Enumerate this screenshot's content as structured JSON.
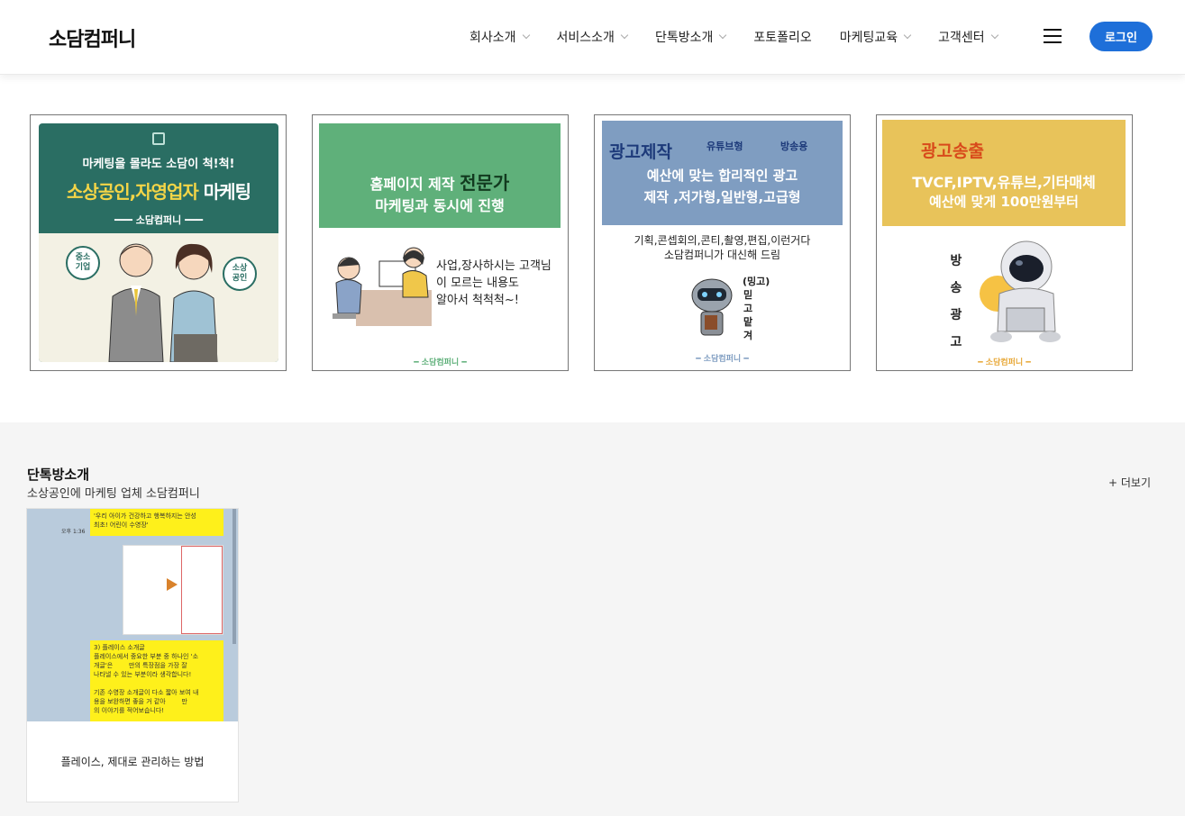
{
  "header": {
    "logo": "소담컴퍼니",
    "nav": [
      {
        "label": "회사소개",
        "has_dropdown": true
      },
      {
        "label": "서비스소개",
        "has_dropdown": true
      },
      {
        "label": "단톡방소개",
        "has_dropdown": true
      },
      {
        "label": "포토폴리오",
        "has_dropdown": false
      },
      {
        "label": "마케팅교육",
        "has_dropdown": true
      },
      {
        "label": "고객센터",
        "has_dropdown": true
      }
    ],
    "menu_icon": "hamburger-icon",
    "login_label": "로그인",
    "accent_color": "#1e6fd9"
  },
  "banners": [
    {
      "top_text": "마케팅을 몰라도 소담이 척!척!",
      "main_highlight": "소상공인,자영업자",
      "main_rest": "마케팅",
      "brand": "━━━ 소담컴퍼니 ━━━",
      "badge_left": "중소\n기업",
      "badge_right": "소상\n공인",
      "bg_color": "#2a6e63"
    },
    {
      "line1_a": "홈페이지 제작",
      "line1_b": "전문가",
      "line2": "마케팅과 동시에 진행",
      "body": "사업,장사하시는 고객님\n이 모르는 내용도\n알아서 척척척~!",
      "brand": "━  소담컴퍼니  ━",
      "bg_color": "#5fb07a"
    },
    {
      "title": "광고제작",
      "tag1": "유튜브형",
      "tag2": "방송용",
      "line1": "예산에 맞는 합리적인 광고",
      "line2": "제작 ,저가형,일반형,고급형",
      "body": "기획,콘셉회의,콘티,촬영,편집,이런거다\n소담컴퍼니가 대신해 드림",
      "vertical": "(밍고)\n믿\n고\n맡\n겨",
      "brand": "━  소담컴퍼니  ━",
      "bg_color": "#7f9dc1"
    },
    {
      "title": "광고송출",
      "line1": "TVCF,IPTV,유튜브,기타매체",
      "line2": "예산에 맞게  100만원부터",
      "vertical": "방\n송\n광\n고",
      "brand": "━  소담컴퍼니  ━",
      "bg_color": "#e8c35a"
    }
  ],
  "section": {
    "title": "단톡방소개",
    "subtitle": "소상공인에 마케팅 업체 소담컴퍼니",
    "more_label": "+ 더보기",
    "cards": [
      {
        "title": "플레이스, 제대로 관리하는 방법",
        "chat_time": "오후 1:36",
        "bubble_top": "'우리 아이가 건강하고 행복하지는 안성\n최초! 어린이 수영장'",
        "bubble_bottom": "3) 플레이스 소개글\n플레이스에서 중요한 부분 중 하나인 '소\n개글'은        만의 특장점을 가장 잘\n나타낼 수 있는 부분이라 생각합니다!\n\n기존 수영장 소개글이 다소 짧아 보여 내\n용을 보완하면 좋을 거 같아        만\n의 이야기를 적어보습니다!"
      }
    ]
  }
}
